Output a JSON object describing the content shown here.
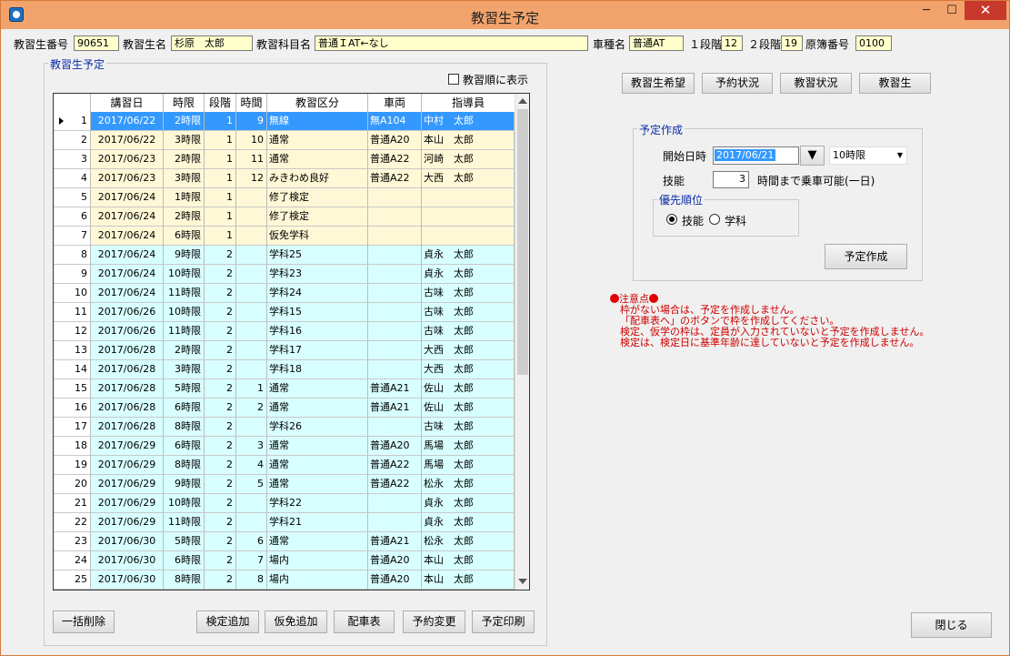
{
  "window": {
    "title": "教習生予定"
  },
  "header": {
    "student_no_label": "教習生番号",
    "student_no": "90651",
    "student_name_label": "教習生名",
    "student_name": "杉原　太郎",
    "course_label": "教習科目名",
    "course": "普通ＩAT←なし",
    "car_type_label": "車種名",
    "car_type": "普通AT",
    "stage1_label": "１段階",
    "stage1": "12",
    "stage2_label": "２段階",
    "stage2": "19",
    "ledger_label": "原簿番号",
    "ledger": "0100"
  },
  "schedule": {
    "group_title": "教習生予定",
    "order_checkbox_label": "教習順に表示",
    "columns": [
      "講習日",
      "時限",
      "段階",
      "時間",
      "教習区分",
      "車両",
      "指導員"
    ],
    "rows": [
      {
        "no": "1",
        "date": "2017/06/22",
        "period": "2時限",
        "stage": "1",
        "hour": "9",
        "kind": "無線",
        "car": "無A104",
        "instructor": "中村　太郎",
        "color": "s"
      },
      {
        "no": "2",
        "date": "2017/06/22",
        "period": "3時限",
        "stage": "1",
        "hour": "10",
        "kind": "通常",
        "car": "普通A20",
        "instructor": "本山　太郎",
        "color": "y"
      },
      {
        "no": "3",
        "date": "2017/06/23",
        "period": "2時限",
        "stage": "1",
        "hour": "11",
        "kind": "通常",
        "car": "普通A22",
        "instructor": "河崎　太郎",
        "color": "y"
      },
      {
        "no": "4",
        "date": "2017/06/23",
        "period": "3時限",
        "stage": "1",
        "hour": "12",
        "kind": "みきわめ良好",
        "car": "普通A22",
        "instructor": "大西　太郎",
        "color": "y"
      },
      {
        "no": "5",
        "date": "2017/06/24",
        "period": "1時限",
        "stage": "1",
        "hour": "",
        "kind": "修了検定",
        "car": "",
        "instructor": "",
        "color": "y"
      },
      {
        "no": "6",
        "date": "2017/06/24",
        "period": "2時限",
        "stage": "1",
        "hour": "",
        "kind": "修了検定",
        "car": "",
        "instructor": "",
        "color": "y"
      },
      {
        "no": "7",
        "date": "2017/06/24",
        "period": "6時限",
        "stage": "1",
        "hour": "",
        "kind": "仮免学科",
        "car": "",
        "instructor": "",
        "color": "y"
      },
      {
        "no": "8",
        "date": "2017/06/24",
        "period": "9時限",
        "stage": "2",
        "hour": "",
        "kind": "学科25",
        "car": "",
        "instructor": "貞永　太郎",
        "color": "c"
      },
      {
        "no": "9",
        "date": "2017/06/24",
        "period": "10時限",
        "stage": "2",
        "hour": "",
        "kind": "学科23",
        "car": "",
        "instructor": "貞永　太郎",
        "color": "c"
      },
      {
        "no": "10",
        "date": "2017/06/24",
        "period": "11時限",
        "stage": "2",
        "hour": "",
        "kind": "学科24",
        "car": "",
        "instructor": "古味　太郎",
        "color": "c"
      },
      {
        "no": "11",
        "date": "2017/06/26",
        "period": "10時限",
        "stage": "2",
        "hour": "",
        "kind": "学科15",
        "car": "",
        "instructor": "古味　太郎",
        "color": "c"
      },
      {
        "no": "12",
        "date": "2017/06/26",
        "period": "11時限",
        "stage": "2",
        "hour": "",
        "kind": "学科16",
        "car": "",
        "instructor": "古味　太郎",
        "color": "c"
      },
      {
        "no": "13",
        "date": "2017/06/28",
        "period": "2時限",
        "stage": "2",
        "hour": "",
        "kind": "学科17",
        "car": "",
        "instructor": "大西　太郎",
        "color": "c"
      },
      {
        "no": "14",
        "date": "2017/06/28",
        "period": "3時限",
        "stage": "2",
        "hour": "",
        "kind": "学科18",
        "car": "",
        "instructor": "大西　太郎",
        "color": "c"
      },
      {
        "no": "15",
        "date": "2017/06/28",
        "period": "5時限",
        "stage": "2",
        "hour": "1",
        "kind": "通常",
        "car": "普通A21",
        "instructor": "佐山　太郎",
        "color": "c"
      },
      {
        "no": "16",
        "date": "2017/06/28",
        "period": "6時限",
        "stage": "2",
        "hour": "2",
        "kind": "通常",
        "car": "普通A21",
        "instructor": "佐山　太郎",
        "color": "c"
      },
      {
        "no": "17",
        "date": "2017/06/28",
        "period": "8時限",
        "stage": "2",
        "hour": "",
        "kind": "学科26",
        "car": "",
        "instructor": "古味　太郎",
        "color": "c"
      },
      {
        "no": "18",
        "date": "2017/06/29",
        "period": "6時限",
        "stage": "2",
        "hour": "3",
        "kind": "通常",
        "car": "普通A20",
        "instructor": "馬場　太郎",
        "color": "c"
      },
      {
        "no": "19",
        "date": "2017/06/29",
        "period": "8時限",
        "stage": "2",
        "hour": "4",
        "kind": "通常",
        "car": "普通A22",
        "instructor": "馬場　太郎",
        "color": "c"
      },
      {
        "no": "20",
        "date": "2017/06/29",
        "period": "9時限",
        "stage": "2",
        "hour": "5",
        "kind": "通常",
        "car": "普通A22",
        "instructor": "松永　太郎",
        "color": "c"
      },
      {
        "no": "21",
        "date": "2017/06/29",
        "period": "10時限",
        "stage": "2",
        "hour": "",
        "kind": "学科22",
        "car": "",
        "instructor": "貞永　太郎",
        "color": "c"
      },
      {
        "no": "22",
        "date": "2017/06/29",
        "period": "11時限",
        "stage": "2",
        "hour": "",
        "kind": "学科21",
        "car": "",
        "instructor": "貞永　太郎",
        "color": "c"
      },
      {
        "no": "23",
        "date": "2017/06/30",
        "period": "5時限",
        "stage": "2",
        "hour": "6",
        "kind": "通常",
        "car": "普通A21",
        "instructor": "松永　太郎",
        "color": "c"
      },
      {
        "no": "24",
        "date": "2017/06/30",
        "period": "6時限",
        "stage": "2",
        "hour": "7",
        "kind": "場内",
        "car": "普通A20",
        "instructor": "本山　太郎",
        "color": "c"
      },
      {
        "no": "25",
        "date": "2017/06/30",
        "period": "8時限",
        "stage": "2",
        "hour": "8",
        "kind": "場内",
        "car": "普通A20",
        "instructor": "本山　太郎",
        "color": "c"
      }
    ]
  },
  "top_buttons": {
    "hope": "教習生希望",
    "reservation": "予約状況",
    "lesson": "教習状況",
    "student": "教習生"
  },
  "plan": {
    "group_title": "予定作成",
    "start_label": "開始日時",
    "start_date": "2017/06/21",
    "start_period": "10時限",
    "skill_label": "技能",
    "skill_hours": "3",
    "skill_suffix": "時間まで乗車可能(一日)",
    "priority_title": "優先順位",
    "opt_skill": "技能",
    "opt_academic": "学科",
    "create_button": "予定作成"
  },
  "notes": {
    "title": "注意点",
    "lines": [
      "枠がない場合は、予定を作成しません。",
      "「配車表へ」のボタンで枠を作成してください。",
      "検定、仮学の枠は、定員が入力されていないと予定を作成しません。",
      "検定は、検定日に基準年齢に達していないと予定を作成しません。"
    ]
  },
  "bottom_buttons": {
    "bulk_delete": "一括削除",
    "add_exam": "検定追加",
    "add_permit": "仮免追加",
    "dispatch": "配車表",
    "change": "予約変更",
    "print": "予定印刷",
    "close": "閉じる"
  },
  "colors": {
    "titlebar": "#f2a36b",
    "selected": "#3399ff",
    "stage1": "#fff8d6",
    "stage2": "#d8ffff",
    "note": "#cc0000"
  }
}
